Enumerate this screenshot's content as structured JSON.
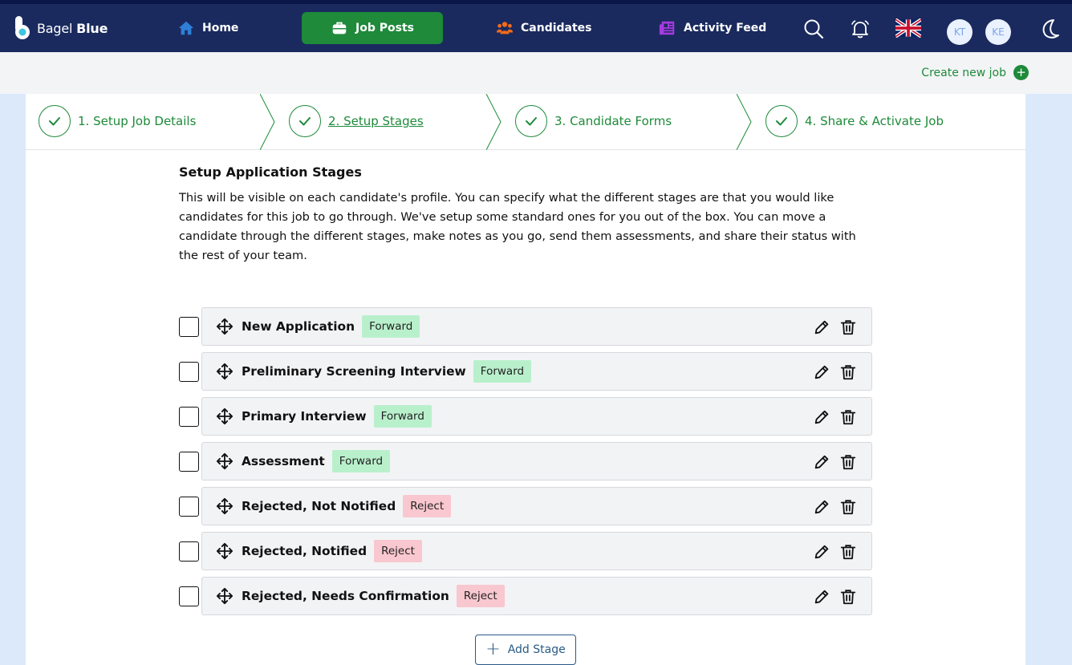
{
  "app": {
    "brand_light": "Bagel",
    "brand_bold": "Blue"
  },
  "nav": {
    "home": "Home",
    "job_posts": "Job Posts",
    "candidates": "Candidates",
    "activity_feed": "Activity Feed",
    "avatars": [
      "KT",
      "KE"
    ]
  },
  "colors": {
    "nav_bg": "#1a2a5e",
    "accent_green": "#1e8a3a",
    "forward_tag": "#b9f0cc",
    "reject_tag": "#f9c7cf",
    "page_bg": "#dce9fb"
  },
  "subbar": {
    "create_job": "Create new job"
  },
  "steps": [
    {
      "label": "1. Setup Job Details",
      "done": true
    },
    {
      "label": "2. Setup Stages",
      "done": true,
      "active": true
    },
    {
      "label": "3. Candidate Forms",
      "done": true
    },
    {
      "label": "4. Share & Activate Job",
      "done": true
    }
  ],
  "section": {
    "title": "Setup Application Stages",
    "description": "This will be visible on each candidate's profile. You can specify what the different stages are that you would like candidates for this job to go through. We've setup some standard ones for you out of the box. You can move a candidate through the different stages, make notes as you go, send them assessments, and share their status with the rest of your team."
  },
  "stages": [
    {
      "name": "New Application",
      "tag": "Forward"
    },
    {
      "name": "Preliminary Screening Interview",
      "tag": "Forward"
    },
    {
      "name": "Primary Interview",
      "tag": "Forward"
    },
    {
      "name": "Assessment",
      "tag": "Forward"
    },
    {
      "name": "Rejected, Not Notified",
      "tag": "Reject"
    },
    {
      "name": "Rejected, Notified",
      "tag": "Reject"
    },
    {
      "name": "Rejected, Needs Confirmation",
      "tag": "Reject"
    }
  ],
  "add_stage": "Add Stage"
}
